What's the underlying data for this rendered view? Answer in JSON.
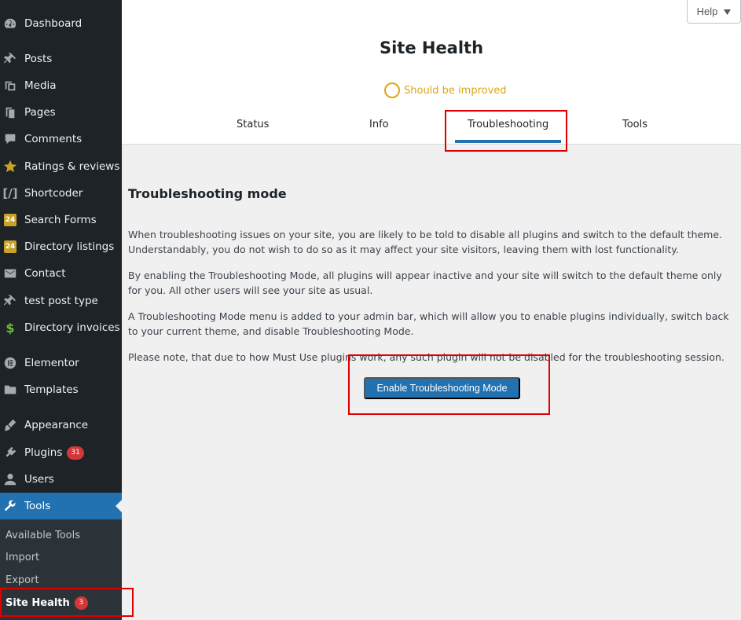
{
  "sidebar": {
    "items": [
      {
        "label": "Dashboard",
        "icon": "dashboard-icon"
      },
      {
        "label": "Posts",
        "icon": "pin-icon"
      },
      {
        "label": "Media",
        "icon": "media-icon"
      },
      {
        "label": "Pages",
        "icon": "pages-icon"
      },
      {
        "label": "Comments",
        "icon": "comment-icon"
      },
      {
        "label": "Ratings & reviews",
        "icon": "star-icon"
      },
      {
        "label": "Shortcoder",
        "icon": "shortcode-icon"
      },
      {
        "label": "Search Forms",
        "icon": "search-forms-icon"
      },
      {
        "label": "Directory listings",
        "icon": "directory-icon"
      },
      {
        "label": "Contact",
        "icon": "envelope-icon"
      },
      {
        "label": "test post type",
        "icon": "pin-icon"
      },
      {
        "label": "Directory invoices",
        "icon": "dollar-icon"
      },
      {
        "label": "Elementor",
        "icon": "elementor-icon"
      },
      {
        "label": "Templates",
        "icon": "folder-icon"
      },
      {
        "label": "Appearance",
        "icon": "brush-icon"
      },
      {
        "label": "Plugins",
        "icon": "plugin-icon",
        "badge": "31"
      },
      {
        "label": "Users",
        "icon": "user-icon"
      },
      {
        "label": "Tools",
        "icon": "wrench-icon",
        "active": true
      }
    ],
    "submenu": [
      {
        "label": "Available Tools"
      },
      {
        "label": "Import"
      },
      {
        "label": "Export"
      },
      {
        "label": "Site Health",
        "badge": "3",
        "current": true
      }
    ]
  },
  "header": {
    "help_label": "Help",
    "title": "Site Health",
    "status_text": "Should be improved",
    "tabs": [
      "Status",
      "Info",
      "Troubleshooting",
      "Tools"
    ],
    "active_tab": "Troubleshooting"
  },
  "main": {
    "section_title": "Troubleshooting mode",
    "paragraphs": [
      "When troubleshooting issues on your site, you are likely to be told to disable all plugins and switch to the default theme. Understandably, you do not wish to do so as it may affect your site visitors, leaving them with lost functionality.",
      "By enabling the Troubleshooting Mode, all plugins will appear inactive and your site will switch to the default theme only for you. All other users will see your site as usual.",
      "A Troubleshooting Mode menu is added to your admin bar, which will allow you to enable plugins individually, switch back to your current theme, and disable Troubleshooting Mode.",
      "Please note, that due to how Must Use plugins work, any such plugin will not be disabled for the troubleshooting session."
    ],
    "enable_button": "Enable Troubleshooting Mode"
  },
  "colors": {
    "sidebar_bg": "#1d2327",
    "accent": "#2271b1",
    "warning": "#dba617",
    "badge": "#d63638",
    "highlight": "#e00000"
  }
}
